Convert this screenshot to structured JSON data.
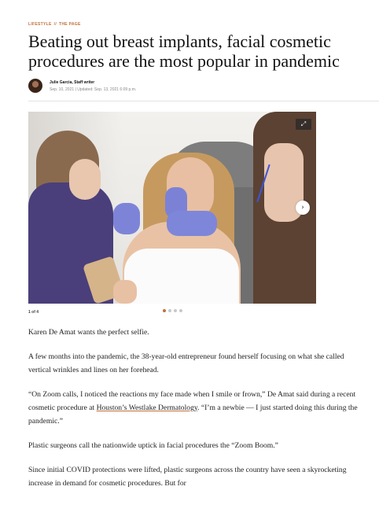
{
  "article": {
    "kicker": {
      "section": "LIFESTYLE",
      "separator": "//",
      "subsection": "THE PAGE"
    },
    "headline": "Beating out breast implants, facial cosmetic procedures are the most popular in pandemic",
    "author": "Julie Garcia, Staff writer",
    "dates": "Sep. 10, 2021 | Updated: Sep. 13, 2021 6:09 p.m.",
    "gallery": {
      "counter": "1 of 4",
      "slide_count": 4,
      "active_slide": 1,
      "expand_icon": "expand-icon",
      "next_icon": "chevron-right-icon"
    },
    "body": {
      "p1": "Karen De Amat wants the perfect selfie.",
      "p2": "A few months into the pandemic, the 38-year-old entrepreneur found herself focusing on what she called vertical wrinkles and lines on her forehead.",
      "p3_before": "“On Zoom calls, I noticed the reactions my face made when I smile or frown,” De Amat said during a recent cosmetic procedure at ",
      "p3_link": "Houston’s Westlake Dermatology",
      "p3_after": ". “I’m a newbie — I just started doing this during the pandemic.”",
      "p4": "Plastic surgeons call the nationwide uptick in facial procedures the “Zoom Boom.”",
      "p5": "Since initial COVID protections were lifted, plastic surgeons across the country have seen a skyrocketing increase in demand for cosmetic procedures. But for"
    }
  },
  "colors": {
    "accent": "#c0703a",
    "text": "#1e1e1e",
    "muted": "#888888"
  }
}
